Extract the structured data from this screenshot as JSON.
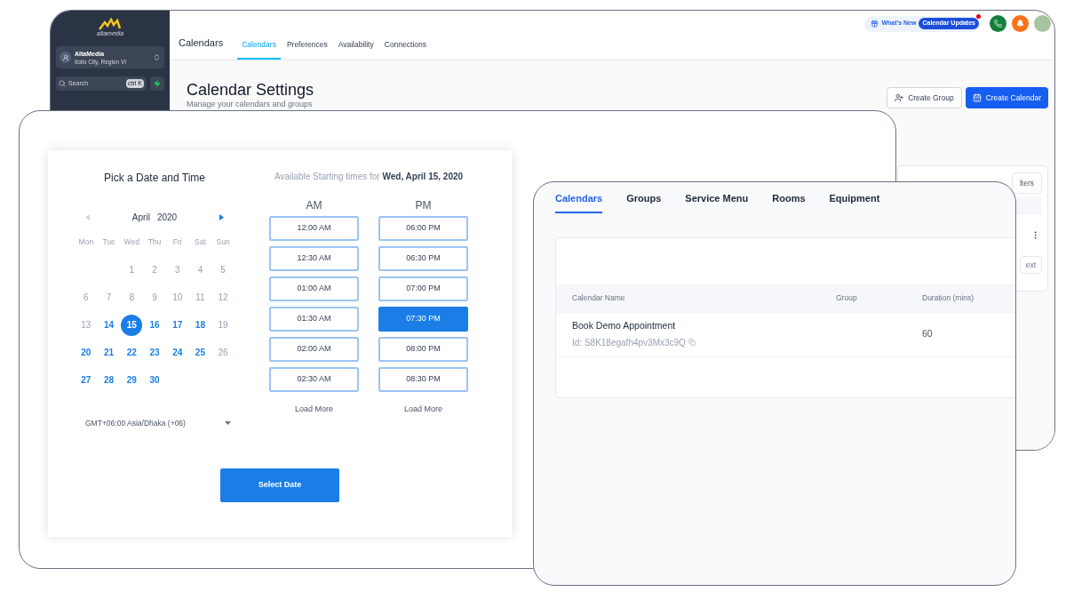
{
  "app_window": {
    "sidebar": {
      "logo_text": "altamedia",
      "account": {
        "name": "AltaMedia",
        "location": "Iloilo City, Region VI"
      },
      "search": {
        "placeholder": "Search",
        "shortcut": "ctrl K"
      }
    },
    "header": {
      "title": "Calendars",
      "tabs": [
        {
          "label": "Calendars",
          "selected": true
        },
        {
          "label": "Preferences",
          "selected": false
        },
        {
          "label": "Availability",
          "selected": false
        },
        {
          "label": "Connections",
          "selected": false
        }
      ],
      "whats_new": "What's New",
      "updates_badge": "Calendar Updates"
    },
    "page": {
      "title": "Calendar Settings",
      "subtitle": "Manage your calendars and groups",
      "buttons": [
        {
          "label": "Create Group",
          "kind": "secondary"
        },
        {
          "label": "Create Calendar",
          "kind": "primary"
        }
      ]
    },
    "table_fragment": {
      "filter_button": "lters",
      "pager_button": "ext"
    }
  },
  "date_picker": {
    "title": "Pick a Date and Time",
    "month": "April",
    "year": "2020",
    "weekdays": [
      "Mon",
      "Tue",
      "Wed",
      "Thu",
      "Fri",
      "Sat",
      "Sun"
    ],
    "weeks": [
      [
        {
          "day": "1",
          "available": false,
          "selected": false
        },
        {
          "day": "2",
          "available": false,
          "selected": false
        },
        {
          "day": "3",
          "available": false,
          "selected": false
        },
        {
          "day": "4",
          "available": false,
          "selected": false
        },
        {
          "day": "5",
          "available": false,
          "selected": false
        }
      ],
      [
        {
          "day": "6",
          "available": false,
          "selected": false
        },
        {
          "day": "7",
          "available": false,
          "selected": false
        },
        {
          "day": "8",
          "available": false,
          "selected": false
        },
        {
          "day": "9",
          "available": false,
          "selected": false
        },
        {
          "day": "10",
          "available": false,
          "selected": false
        },
        {
          "day": "11",
          "available": false,
          "selected": false
        },
        {
          "day": "12",
          "available": false,
          "selected": false
        }
      ],
      [
        {
          "day": "13",
          "available": false,
          "selected": false
        },
        {
          "day": "14",
          "available": true,
          "selected": false
        },
        {
          "day": "15",
          "available": true,
          "selected": true
        },
        {
          "day": "16",
          "available": true,
          "selected": false
        },
        {
          "day": "17",
          "available": true,
          "selected": false
        },
        {
          "day": "18",
          "available": true,
          "selected": false
        },
        {
          "day": "19",
          "available": false,
          "selected": false
        }
      ],
      [
        {
          "day": "20",
          "available": true,
          "selected": false
        },
        {
          "day": "21",
          "available": true,
          "selected": false
        },
        {
          "day": "22",
          "available": true,
          "selected": false
        },
        {
          "day": "23",
          "available": true,
          "selected": false
        },
        {
          "day": "24",
          "available": true,
          "selected": false
        },
        {
          "day": "25",
          "available": true,
          "selected": false
        },
        {
          "day": "26",
          "available": false,
          "selected": false
        }
      ],
      [
        {
          "day": "27",
          "available": true,
          "selected": false
        },
        {
          "day": "28",
          "available": true,
          "selected": false
        },
        {
          "day": "29",
          "available": true,
          "selected": false
        },
        {
          "day": "30",
          "available": true,
          "selected": false
        }
      ]
    ],
    "timezone": "GMT+06:00 Asia/Dhaka (+06)",
    "times_heading": "Available Starting times for",
    "selected_date": "Wed, April 15, 2020",
    "columns": [
      {
        "heading": "AM",
        "load_more": "Load More",
        "slots": [
          {
            "time": "12:00 AM",
            "selected": false
          },
          {
            "time": "12:30 AM",
            "selected": false
          },
          {
            "time": "01:00 AM",
            "selected": false
          },
          {
            "time": "01:30 AM",
            "selected": false
          },
          {
            "time": "02:00 AM",
            "selected": false
          },
          {
            "time": "02:30 AM",
            "selected": false
          }
        ]
      },
      {
        "heading": "PM",
        "load_more": "Load More",
        "slots": [
          {
            "time": "06:00 PM",
            "selected": false
          },
          {
            "time": "06:30 PM",
            "selected": false
          },
          {
            "time": "07:00 PM",
            "selected": false
          },
          {
            "time": "07:30 PM",
            "selected": true
          },
          {
            "time": "08:00 PM",
            "selected": false
          },
          {
            "time": "08:30 PM",
            "selected": false
          }
        ]
      }
    ],
    "select_button": "Select Date"
  },
  "calendars_panel": {
    "tabs": [
      {
        "label": "Calendars",
        "selected": true
      },
      {
        "label": "Groups",
        "selected": false
      },
      {
        "label": "Service Menu",
        "selected": false
      },
      {
        "label": "Rooms",
        "selected": false
      },
      {
        "label": "Equipment",
        "selected": false
      }
    ],
    "columns": [
      "Calendar Name",
      "Group",
      "Duration (mins)"
    ],
    "rows": [
      {
        "name": "Book Demo Appointment",
        "id": "Id: S8K18egafh4pv3Mx3c9Q",
        "duration": "60"
      }
    ]
  }
}
